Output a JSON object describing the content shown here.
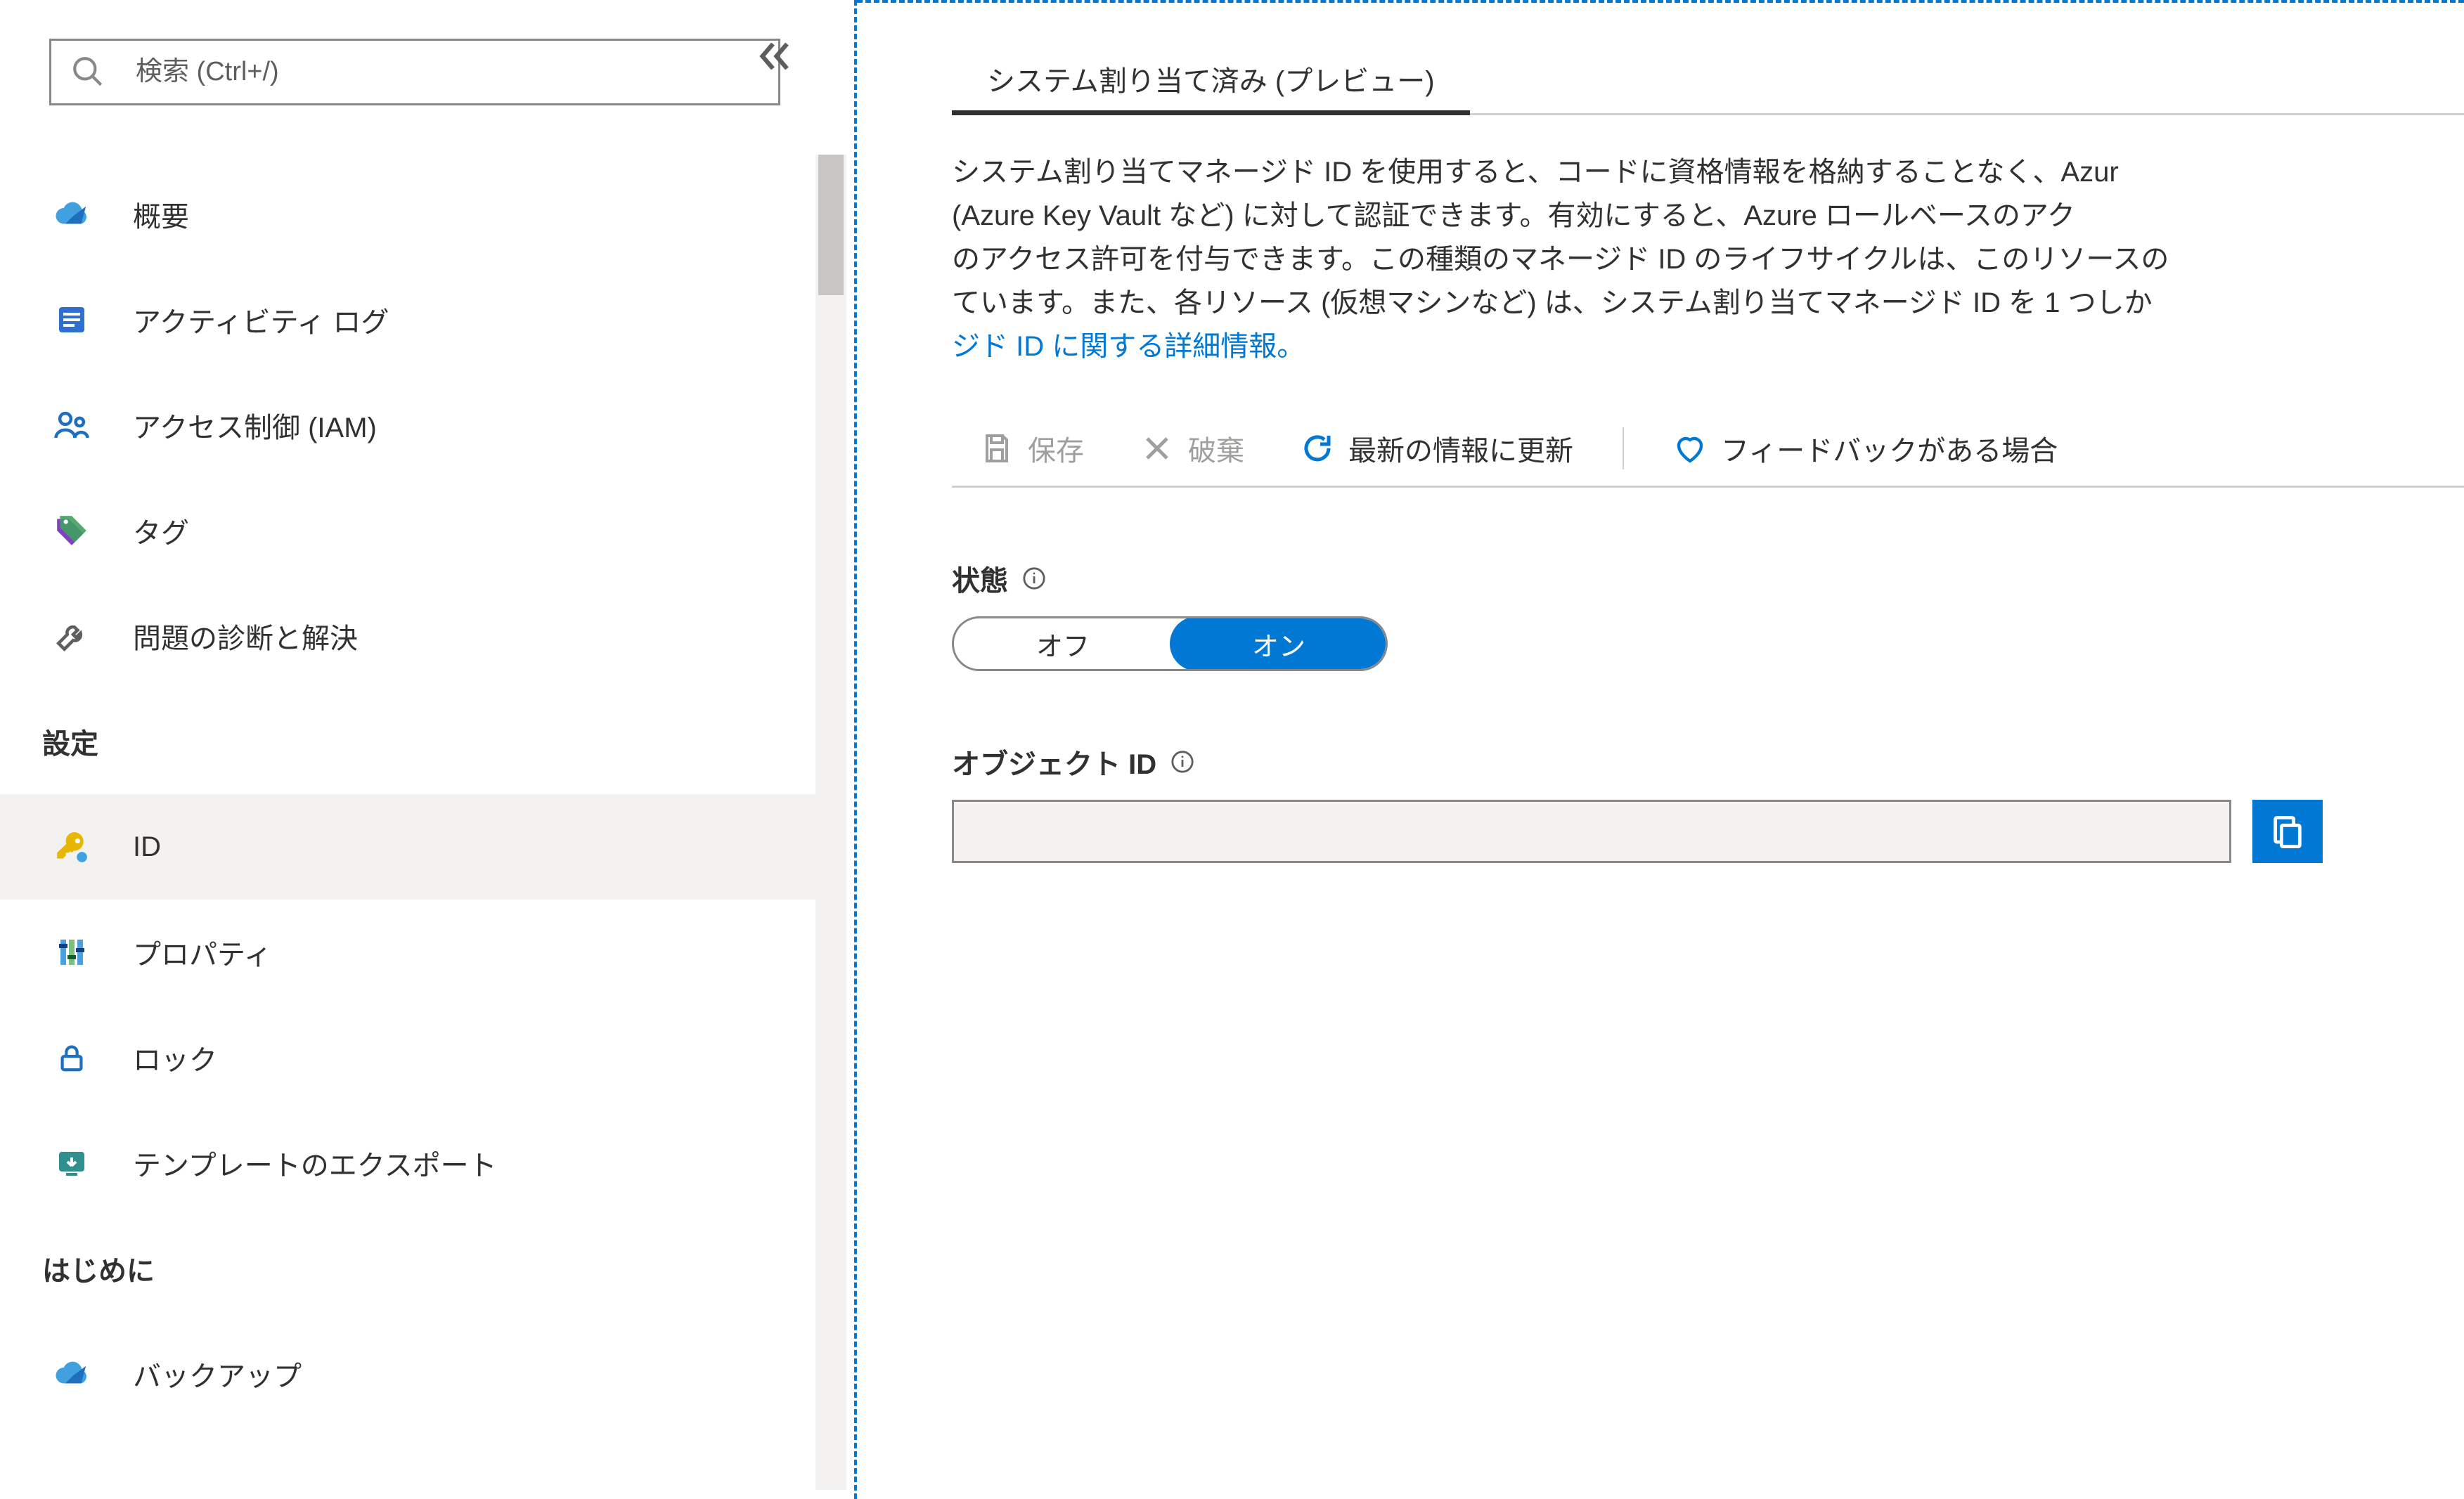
{
  "search": {
    "placeholder": "検索 (Ctrl+/)"
  },
  "nav": {
    "top": [
      {
        "key": "overview",
        "label": "概要"
      },
      {
        "key": "activity-log",
        "label": "アクティビティ ログ"
      },
      {
        "key": "iam",
        "label": "アクセス制御 (IAM)"
      },
      {
        "key": "tags",
        "label": "タグ"
      },
      {
        "key": "diagnose",
        "label": "問題の診断と解決"
      }
    ],
    "settings_header": "設定",
    "settings": [
      {
        "key": "identity",
        "label": "ID",
        "selected": true
      },
      {
        "key": "properties",
        "label": "プロパティ"
      },
      {
        "key": "locks",
        "label": "ロック"
      },
      {
        "key": "export-template",
        "label": "テンプレートのエクスポート"
      }
    ],
    "getting_started_header": "はじめに",
    "getting_started": [
      {
        "key": "backup",
        "label": "バックアップ"
      }
    ]
  },
  "tabs": {
    "system_assigned": "システム割り当て済み (プレビュー)"
  },
  "description": {
    "line1": "システム割り当てマネージド ID を使用すると、コードに資格情報を格納することなく、Azur",
    "line2": "(Azure Key Vault など) に対して認証できます。有効にすると、Azure ロールベースのアク",
    "line3": "のアクセス許可を付与できます。この種類のマネージド ID のライフサイクルは、このリソースの",
    "line4": "ています。また、各リソース (仮想マシンなど) は、システム割り当てマネージド ID を 1 つしか",
    "link": "ジド ID に関する詳細情報。"
  },
  "toolbar": {
    "save": "保存",
    "discard": "破棄",
    "refresh": "最新の情報に更新",
    "feedback": "フィードバックがある場合"
  },
  "status": {
    "label": "状態",
    "off": "オフ",
    "on": "オン",
    "value": "on"
  },
  "object_id": {
    "label": "オブジェクト ID",
    "value": ""
  },
  "colors": {
    "accent": "#0078d4",
    "border": "#8a8886",
    "muted": "#a19f9d",
    "text": "#323130"
  }
}
